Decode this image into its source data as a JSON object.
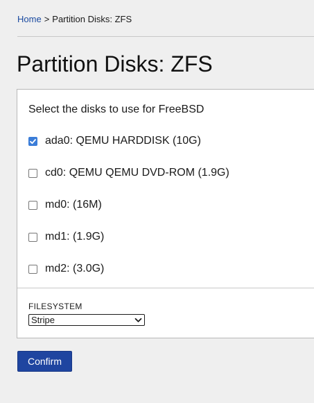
{
  "breadcrumb": {
    "home_label": "Home",
    "separator": ">",
    "current_label": "Partition Disks: ZFS"
  },
  "page": {
    "title": "Partition Disks: ZFS"
  },
  "disk_selection": {
    "heading": "Select the disks to use for FreeBSD",
    "disks": [
      {
        "label": "ada0: QEMU HARDDISK (10G)",
        "checked": true
      },
      {
        "label": "cd0: QEMU QEMU DVD-ROM (1.9G)",
        "checked": false
      },
      {
        "label": "md0: (16M)",
        "checked": false
      },
      {
        "label": "md1: (1.9G)",
        "checked": false
      },
      {
        "label": "md2: (3.0G)",
        "checked": false
      }
    ]
  },
  "filesystem": {
    "label": "FILESYSTEM",
    "selected": "Stripe"
  },
  "actions": {
    "confirm_label": "Confirm"
  },
  "colors": {
    "link": "#1a4aa0",
    "checkbox_checked": "#3b7dd8",
    "primary_button": "#1f45a0"
  }
}
